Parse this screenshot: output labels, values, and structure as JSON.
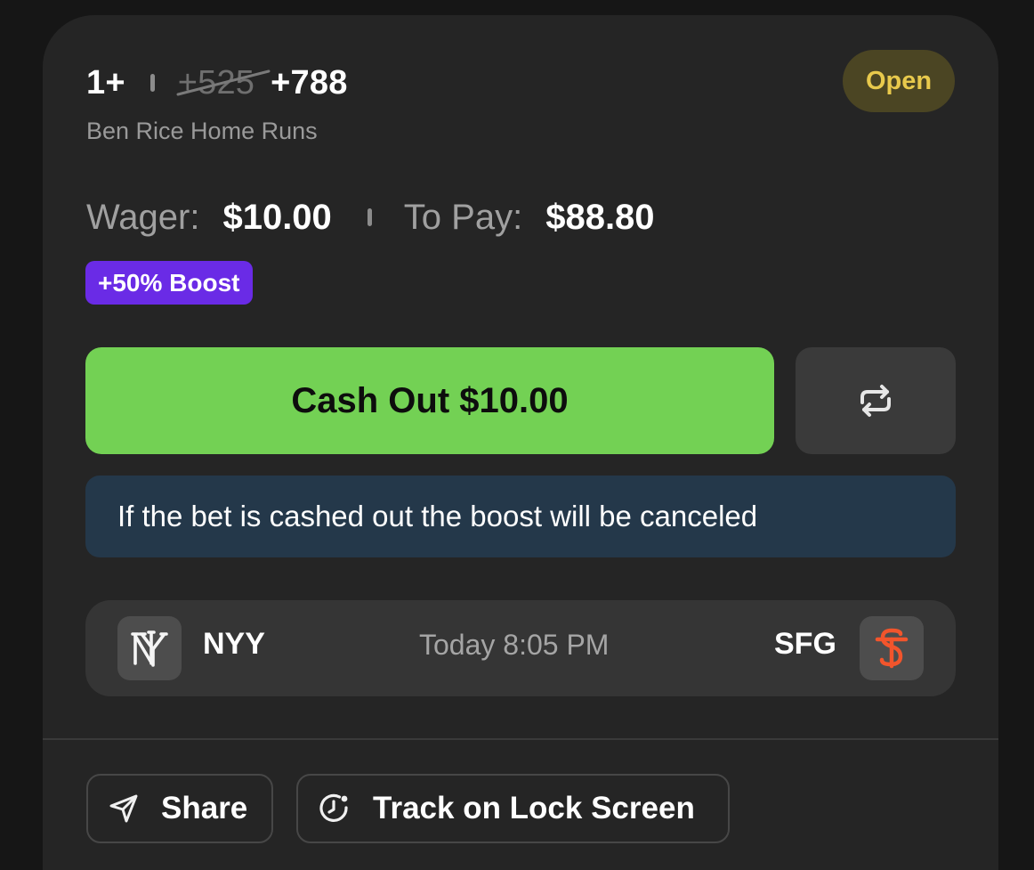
{
  "bet": {
    "line": "1+",
    "original_odds": "+525",
    "boosted_odds": "+788",
    "market": "Ben Rice Home Runs",
    "status": "Open"
  },
  "wager": {
    "wager_label": "Wager:",
    "wager_value": "$10.00",
    "to_pay_label": "To Pay:",
    "to_pay_value": "$88.80",
    "boost_badge": "+50% Boost"
  },
  "actions": {
    "cash_out_label": "Cash Out $10.00",
    "swap_icon": "repeat-arrows-icon",
    "notice": "If the bet is cashed out the boost will be canceled"
  },
  "game": {
    "away_team": "NYY",
    "away_logo": "ny-logo",
    "time": "Today 8:05 PM",
    "home_team": "SFG",
    "home_logo": "sf-logo"
  },
  "footer": {
    "share_label": "Share",
    "share_icon": "send-icon",
    "track_label": "Track on Lock Screen",
    "track_icon": "clock-icon"
  },
  "colors": {
    "background": "#161616",
    "card": "#252525",
    "cash_out": "#73d154",
    "boost": "#6a2be6",
    "open_badge_text": "#e8c94c",
    "notice_bg": "#24384a",
    "sfg_orange": "#f2552c"
  }
}
